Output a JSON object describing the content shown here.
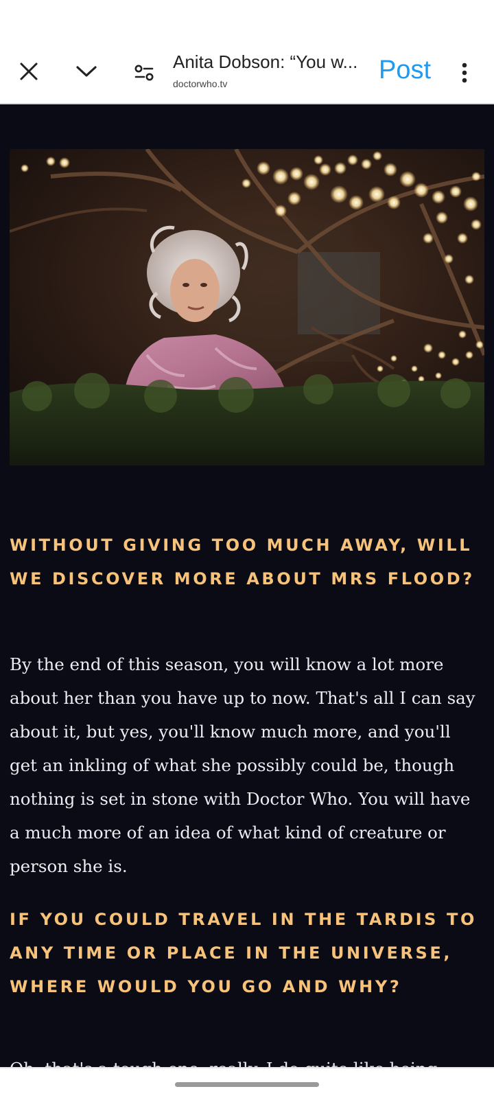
{
  "browser": {
    "page_title": "Anita Dobson: “You w...",
    "url": "doctorwho.tv",
    "post_label": "Post",
    "icons": {
      "close": "close-icon",
      "collapse": "chevron-down-icon",
      "site_settings": "tune-icon",
      "more": "more-vert-icon"
    },
    "accent_color": "#1d9bf0"
  },
  "article": {
    "image_alt": "Mrs Flood in a pink dressing gown in a garden lit by fairy lights",
    "heading1": "WITHOUT GIVING TOO MUCH AWAY, WILL WE DISCOVER MORE ABOUT MRS FLOOD?",
    "paragraph1": "By the end of this season, you will know a lot more about her than you have up to now. That's all I can say about it, but yes, you'll know much more, and you'll get an inkling of what she possibly could be, though nothing is set in stone with Doctor Who. You will have a much more of an idea of what kind of creature or person she is.",
    "heading2": "IF YOU COULD TRAVEL IN THE TARDIS TO ANY TIME OR PLACE IN THE UNIVERSE, WHERE WOULD YOU GO AND WHY?",
    "paragraph2_partial": "Oh, that's a tough one, really. I do quite like being",
    "heading_color": "#f7c37b",
    "background_color": "#0b0b16"
  }
}
